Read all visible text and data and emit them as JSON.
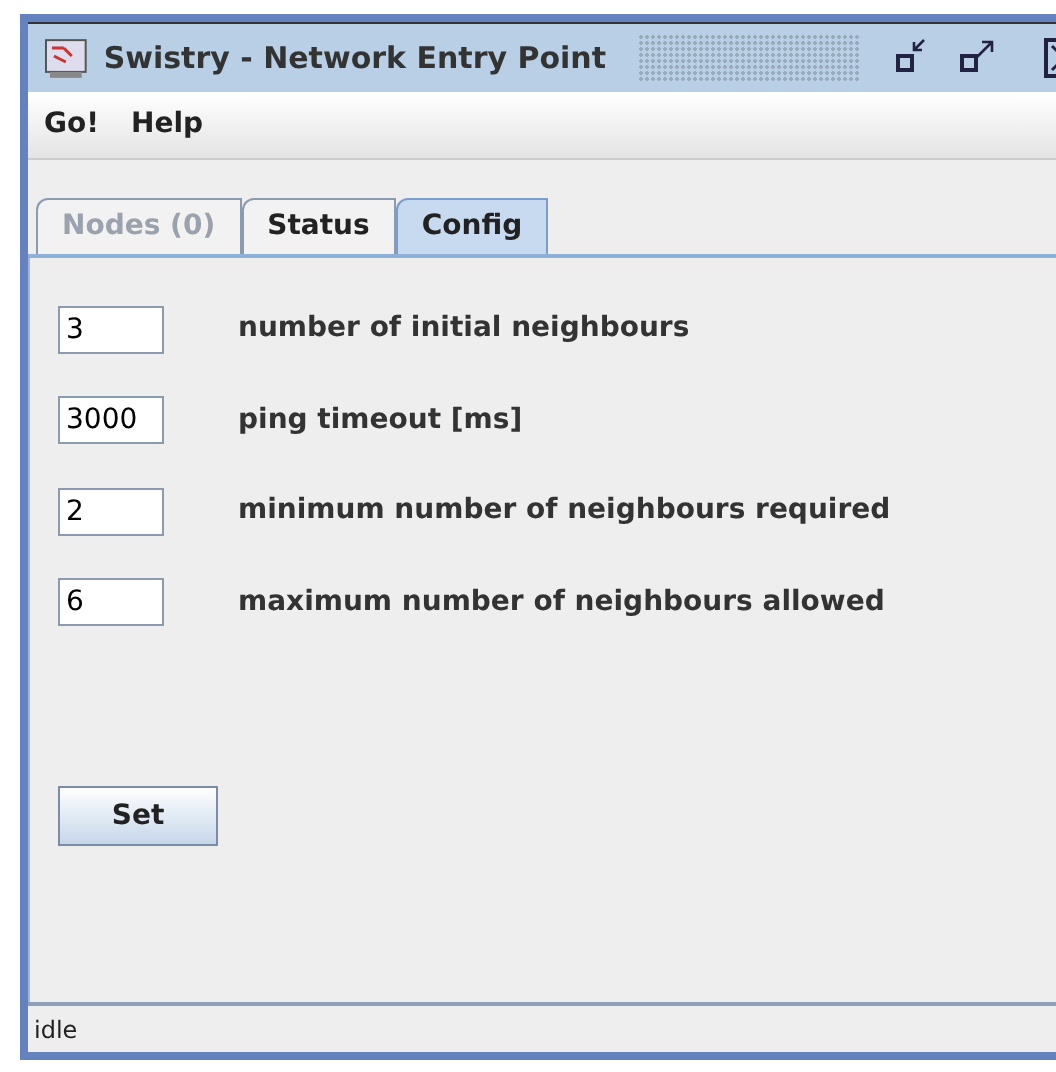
{
  "window": {
    "title": "Swistry - Network Entry Point"
  },
  "menu": [
    "Go!",
    "Help"
  ],
  "tabs": [
    {
      "label": "Nodes (0)",
      "selected": false,
      "disabled": true
    },
    {
      "label": "Status",
      "selected": false,
      "disabled": false
    },
    {
      "label": "Config",
      "selected": true,
      "disabled": false
    }
  ],
  "settings": [
    {
      "value": "3",
      "label": "number of initial neighbours"
    },
    {
      "value": "3000",
      "label": "ping timeout [ms]"
    },
    {
      "value": "2",
      "label": "minimum number of neighbours required"
    },
    {
      "value": "6",
      "label": "maximum number of neighbours allowed"
    }
  ],
  "set_button": "Set",
  "status_bar": "idle"
}
